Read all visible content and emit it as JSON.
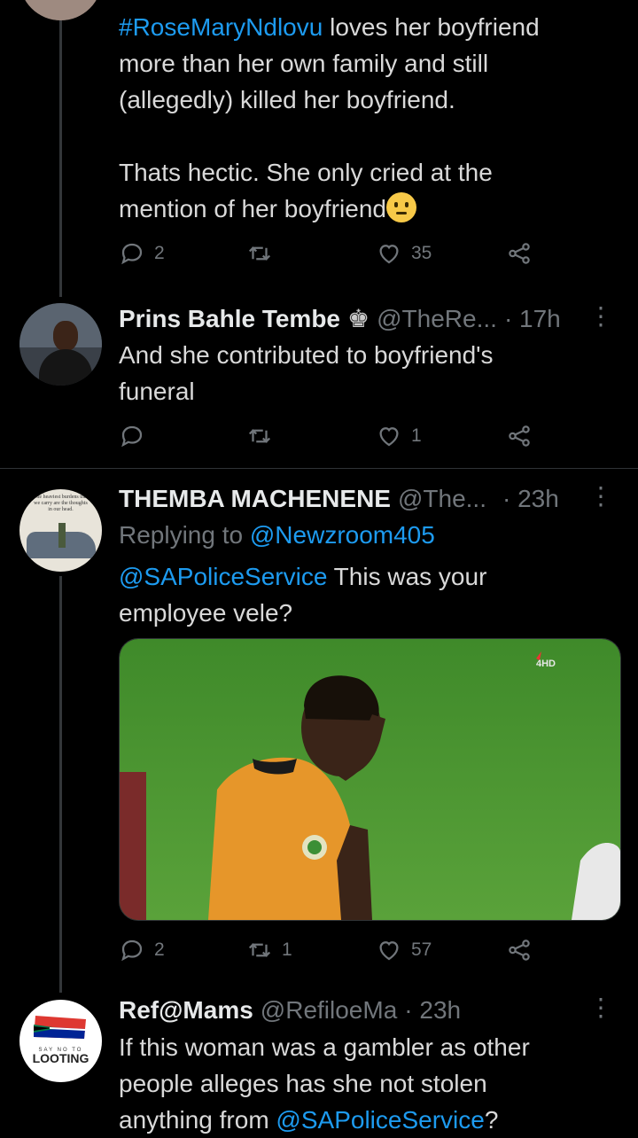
{
  "tweets": [
    {
      "text_line1_link": "#RoseMaryNdlovu",
      "text_line1_rest": " loves her boyfriend",
      "text_line2": "more than her own family and still",
      "text_line3": "(allegedly) killed her boyfriend.",
      "text_line4": "Thats hectic. She only cried at the",
      "text_line5": "mention of her boyfriend",
      "replies": "2",
      "retweets": "",
      "likes": "35"
    },
    {
      "name": "Prins Bahle Tembe",
      "handle": "@TheRe...",
      "time": "· 17h",
      "text_line1": "And she contributed to boyfriend's",
      "text_line2": "funeral",
      "replies": "",
      "retweets": "",
      "likes": "1"
    },
    {
      "name": "THEMBA MACHENENE",
      "handle": "@The...",
      "time": "· 23h",
      "replying_to_label": "Replying to ",
      "replying_to_handle": "@Newzroom405",
      "text_link": "@SAPoliceService",
      "text_rest": " This was your",
      "text_line2": "employee vele?",
      "avatar_text": "The heaviest burdens that we carry are the thoughts in our head.",
      "media_watermark": "4HD",
      "replies": "2",
      "retweets": "1",
      "likes": "57"
    },
    {
      "name": "Ref@Mams",
      "handle": "@RefiloeMa",
      "time": "· 23h",
      "avatar_text": "LOOTING",
      "avatar_subtext": "SAY NO TO",
      "text_line1": "If this woman was a gambler as other",
      "text_line2": "people alleges has she not stolen",
      "text_line3_rest": "anything from ",
      "text_line3_link": "@SAPoliceService",
      "text_line3_end": "?"
    }
  ],
  "icons": {
    "reply": "reply-icon",
    "retweet": "retweet-icon",
    "like": "heart-icon",
    "share": "share-icon",
    "more": "more-icon"
  },
  "colors": {
    "link": "#1d9bf0",
    "muted": "#71767b",
    "background": "#000000"
  }
}
